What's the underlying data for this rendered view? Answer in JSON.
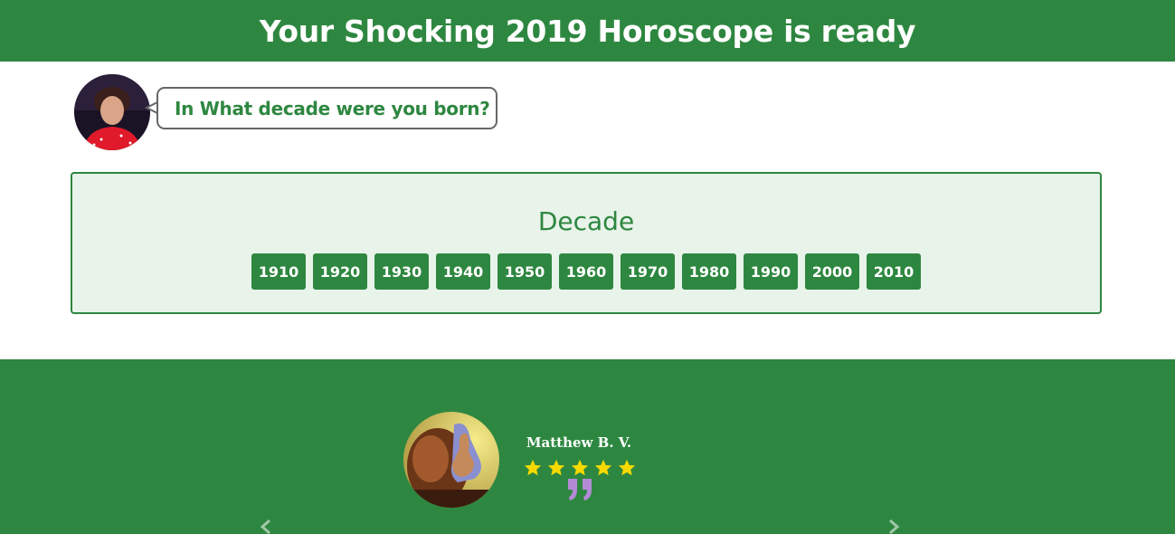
{
  "header": {
    "title": "Your Shocking 2019 Horoscope is ready"
  },
  "chat": {
    "question": "In What decade were you born?",
    "avatar_icon": "psychic-avatar"
  },
  "decade_panel": {
    "title": "Decade",
    "options": [
      "1910",
      "1920",
      "1930",
      "1940",
      "1950",
      "1960",
      "1970",
      "1980",
      "1990",
      "2000",
      "2010"
    ]
  },
  "testimonial": {
    "name": "Matthew B. V.",
    "rating": 5,
    "rating_max": 5,
    "text_visible": "",
    "avatar_icon": "thumbs-up-avatar"
  },
  "colors": {
    "brand_green": "#2e8740",
    "panel_bg": "#e8f3ea",
    "star_yellow": "#f7d900",
    "quote_purple": "#b48ad6"
  }
}
